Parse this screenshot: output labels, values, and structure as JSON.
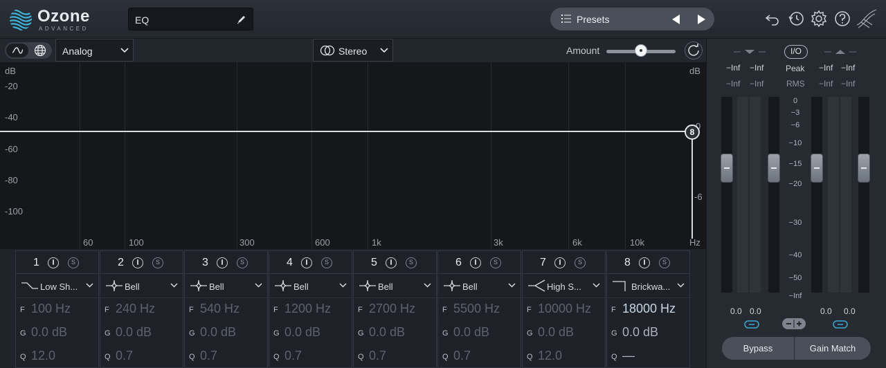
{
  "header": {
    "logo_name": "Ozone",
    "logo_sub": "ADVANCED",
    "module_name": "EQ",
    "presets_label": "Presets",
    "icons": [
      "undo-icon",
      "history-icon",
      "gear-icon",
      "help-icon",
      "signal-chain-icon"
    ]
  },
  "toolbar": {
    "mode": "Analog",
    "channel": "Stereo",
    "amount_label": "Amount",
    "amount_value": 0.5
  },
  "graph": {
    "y_labels": [
      "dB",
      "-20",
      "-40",
      "-60",
      "-80",
      "-100"
    ],
    "freq_labels": [
      "60",
      "100",
      "300",
      "600",
      "1k",
      "3k",
      "6k",
      "10k",
      "Hz"
    ],
    "right_labels": [
      "dB",
      "0",
      "-6"
    ],
    "node_label": "8"
  },
  "bands": [
    {
      "num": "1",
      "shape": "Low Sh...",
      "freq": "100 Hz",
      "gain": "0.0 dB",
      "q": "12.0",
      "active": false
    },
    {
      "num": "2",
      "shape": "Bell",
      "freq": "240 Hz",
      "gain": "0.0 dB",
      "q": "0.7",
      "active": false
    },
    {
      "num": "3",
      "shape": "Bell",
      "freq": "540 Hz",
      "gain": "0.0 dB",
      "q": "0.7",
      "active": false
    },
    {
      "num": "4",
      "shape": "Bell",
      "freq": "1200 Hz",
      "gain": "0.0 dB",
      "q": "0.7",
      "active": false
    },
    {
      "num": "5",
      "shape": "Bell",
      "freq": "2700 Hz",
      "gain": "0.0 dB",
      "q": "0.7",
      "active": false
    },
    {
      "num": "6",
      "shape": "Bell",
      "freq": "5500 Hz",
      "gain": "0.0 dB",
      "q": "0.7",
      "active": false
    },
    {
      "num": "7",
      "shape": "High S...",
      "freq": "10000 Hz",
      "gain": "0.0 dB",
      "q": "12.0",
      "active": false
    },
    {
      "num": "8",
      "shape": "Brickwa...",
      "freq": "18000 Hz",
      "gain": "0.0 dB",
      "q": "—",
      "active": true
    }
  ],
  "param_labels": {
    "f": "F",
    "g": "G",
    "q": "Q"
  },
  "meters": {
    "io_label": "I/O",
    "peak_label": "Peak",
    "rms_label": "RMS",
    "in_peak_l": "−Inf",
    "in_peak_r": "−Inf",
    "in_rms_l": "−Inf",
    "in_rms_r": "−Inf",
    "out_peak_l": "−Inf",
    "out_peak_r": "−Inf",
    "out_rms_l": "−Inf",
    "out_rms_r": "−Inf",
    "scale": [
      "0",
      "−3",
      "−6",
      "−10",
      "−15",
      "−20",
      "−30",
      "−40",
      "−50",
      "−Inf"
    ],
    "in_gain_l": "0.0",
    "in_gain_r": "0.0",
    "out_gain_l": "0.0",
    "out_gain_r": "0.0",
    "bypass_label": "Bypass",
    "gain_match_label": "Gain Match"
  }
}
